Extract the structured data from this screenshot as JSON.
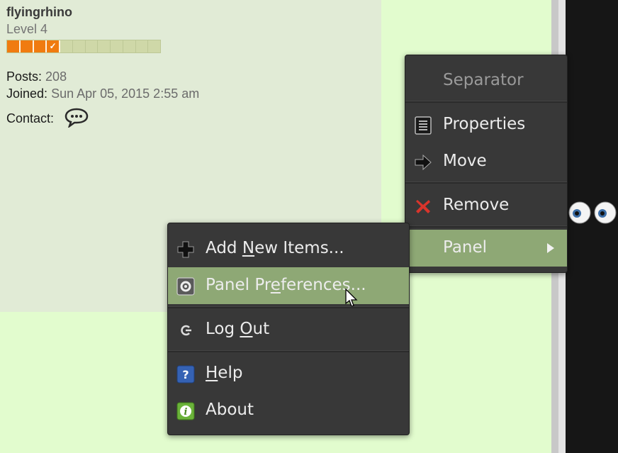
{
  "profile": {
    "username": "flyingrhino",
    "rank": "Level 4",
    "progress": {
      "filled": 4,
      "total": 12
    },
    "posts_label": "Posts:",
    "posts_value": "208",
    "joined_label": "Joined:",
    "joined_value": "Sun Apr 05, 2015 2:55 am",
    "contact_label": "Contact:",
    "contact_icon": "speech-bubble-icon"
  },
  "item_menu": {
    "header": "Separator",
    "items": [
      {
        "label": "Properties",
        "icon": "properties-icon"
      },
      {
        "label": "Move",
        "icon": "arrow-right-icon"
      },
      {
        "label": "Remove",
        "icon": "remove-x-icon"
      },
      {
        "label": "Panel",
        "icon": "submenu-arrow-icon",
        "highlighted": true
      }
    ]
  },
  "panel_menu": {
    "items": [
      {
        "label_parts": [
          "Add ",
          "N",
          "ew Items..."
        ],
        "icon": "add-icon"
      },
      {
        "label_parts": [
          "Panel Pr",
          "e",
          "ferences..."
        ],
        "icon": "preferences-icon",
        "highlighted": true
      },
      {
        "label_parts": [
          "Log ",
          "O",
          "ut"
        ],
        "icon": "logout-icon"
      },
      {
        "label_parts": [
          "",
          "H",
          "elp"
        ],
        "icon": "help-icon"
      },
      {
        "label_parts": [
          "About",
          "",
          ""
        ],
        "icon": "about-icon"
      }
    ]
  },
  "colors": {
    "highlight": "#8ea875",
    "menu_bg": "#383838",
    "progress": "#f07b10",
    "page_bg": "#e2fcce"
  }
}
